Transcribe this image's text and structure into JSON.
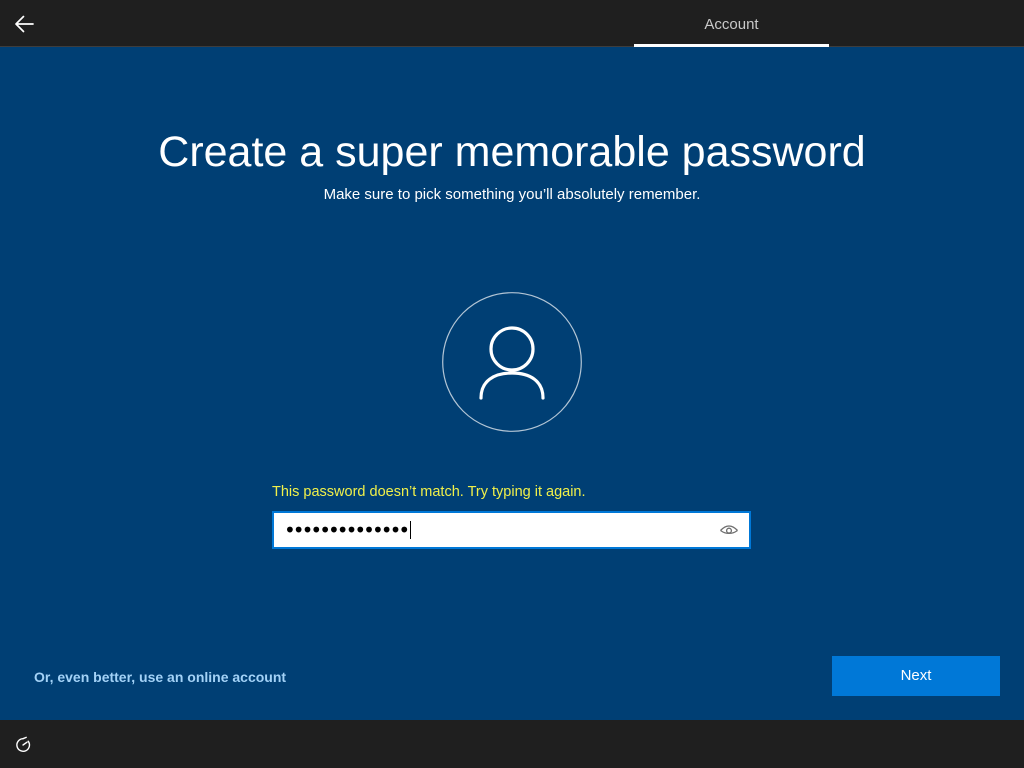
{
  "header": {
    "back_icon": "back-arrow-icon",
    "tab_label": "Account"
  },
  "main": {
    "title": "Create a super memorable password",
    "subtitle": "Make sure to pick something you’ll absolutely remember.",
    "avatar_icon": "user-icon",
    "error_message": "This password doesn’t match. Try typing it again.",
    "password_field": {
      "masked_value": "••••••••••••••",
      "reveal_icon": "eye-icon"
    },
    "online_account_link": "Or, even better, use an online account",
    "next_button": "Next"
  },
  "footer": {
    "accessibility_icon": "ease-of-access-icon"
  },
  "colors": {
    "background": "#003f74",
    "bars": "#1f1f1f",
    "accent": "#0078d7",
    "error_text": "#f0f04a",
    "link_text": "#a3d2f7"
  }
}
